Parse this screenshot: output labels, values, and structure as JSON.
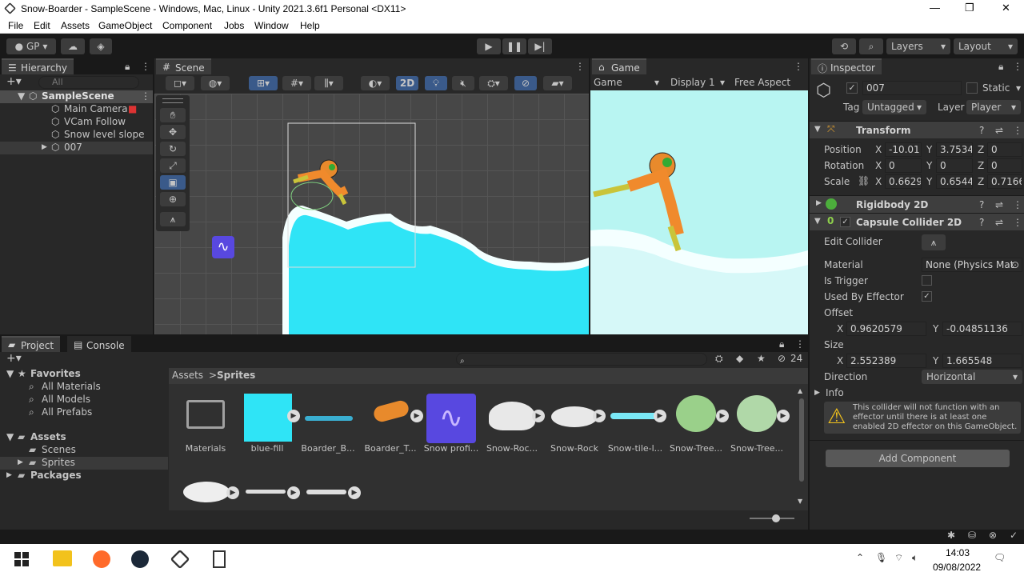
{
  "window": {
    "title": "Snow-Boarder - SampleScene - Windows, Mac, Linux - Unity 2021.3.6f1 Personal <DX11>",
    "minimize": "—",
    "maximize": "❐",
    "close": "✕"
  },
  "menu": [
    "File",
    "Edit",
    "Assets",
    "GameObject",
    "Component",
    "Jobs",
    "Window",
    "Help"
  ],
  "toolbar": {
    "account": "GP",
    "layers": "Layers",
    "layout": "Layout"
  },
  "hierarchy": {
    "tab": "Hierarchy",
    "search_placeholder": "All",
    "scene": "SampleScene",
    "items": [
      "Main Camera",
      "VCam Follow",
      "Snow level slope",
      "007"
    ]
  },
  "scene": {
    "tab": "Scene",
    "mode_2d": "2D"
  },
  "game": {
    "tab": "Game",
    "view": "Game",
    "display": "Display 1",
    "aspect": "Free Aspect"
  },
  "inspector": {
    "tab": "Inspector",
    "object_name": "007",
    "static_label": "Static",
    "tag_label": "Tag",
    "tag_value": "Untagged",
    "layer_label": "Layer",
    "layer_value": "Player",
    "transform": {
      "title": "Transform",
      "position_label": "Position",
      "rotation_label": "Rotation",
      "scale_label": "Scale",
      "pos": [
        "-10.01",
        "3.7534",
        "0"
      ],
      "rot": [
        "0",
        "0",
        "0"
      ],
      "scale": [
        "0.6629",
        "0.6544",
        "0.7166"
      ],
      "x": "X",
      "y": "Y",
      "z": "Z"
    },
    "rigidbody": {
      "title": "Rigidbody 2D"
    },
    "capsule": {
      "title": "Capsule Collider 2D",
      "edit_collider": "Edit Collider",
      "material_label": "Material",
      "material_value": "None (Physics Mat",
      "is_trigger": "Is Trigger",
      "used_by_effector": "Used By Effector",
      "offset_label": "Offset",
      "offset_x": "0.9620579",
      "offset_y": "-0.04851136",
      "size_label": "Size",
      "size_x": "2.552389",
      "size_y": "1.665548",
      "direction_label": "Direction",
      "direction_value": "Horizontal",
      "info_label": "Info",
      "warning": "This collider will not function with an effector until there is at least one enabled 2D effector on this GameObject."
    },
    "add_component": "Add Component"
  },
  "project": {
    "tab_project": "Project",
    "tab_console": "Console",
    "hidden_count": "24",
    "favorites": "Favorites",
    "fav_items": [
      "All Materials",
      "All Models",
      "All Prefabs"
    ],
    "assets": "Assets",
    "asset_folders": [
      "Scenes",
      "Sprites"
    ],
    "packages": "Packages",
    "breadcrumb": [
      "Assets",
      "Sprites"
    ],
    "tiles": [
      "Materials",
      "blue-fill",
      "Boarder_B...",
      "Boarder_T...",
      "Snow profi...",
      "Snow-Roc...",
      "Snow-Rock",
      "Snow-tile-l...",
      "Snow-Tree...",
      "Snow-Tree..."
    ]
  },
  "taskbar": {
    "time": "14:03",
    "date": "09/08/2022"
  },
  "colors": {
    "accent": "#3a72b0",
    "snow": "#2fe4f6",
    "sky": "#b8f5f2"
  }
}
